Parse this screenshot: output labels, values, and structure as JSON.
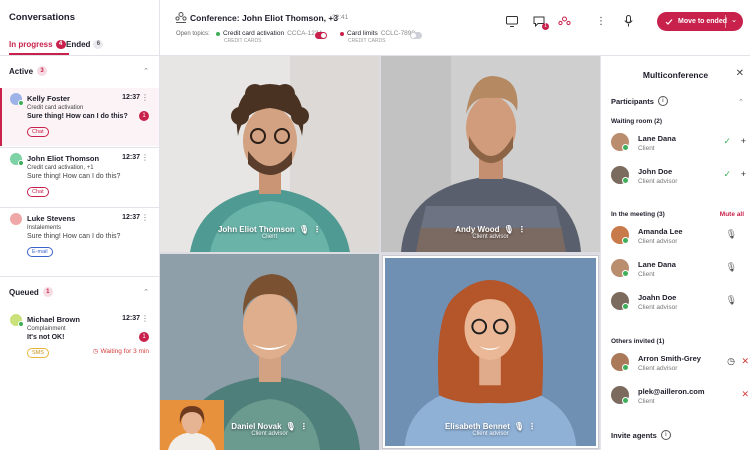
{
  "sidebar": {
    "title": "Conversations",
    "tabs": [
      {
        "label": "In progress",
        "count": "4"
      },
      {
        "label": "Ended",
        "count": "6"
      }
    ],
    "active_section": {
      "label": "Active",
      "count": "3"
    },
    "queued_section": {
      "label": "Queued",
      "count": "1"
    },
    "conversations": [
      {
        "name": "Kelly Foster",
        "time": "12:37",
        "subject": "Credit card activation",
        "message": "Sure thing! How can I do this?",
        "tag": "Chat",
        "unread": "1"
      },
      {
        "name": "John Eliot Thomson",
        "time": "12:37",
        "subject": "Credit card activation, +1",
        "message": "Sure thing! How can I do this?",
        "tag": "Chat"
      },
      {
        "name": "Luke Stevens",
        "time": "12:37",
        "subject": "Instalements",
        "message": "Sure thing! How can I do this?",
        "tag": "E-mail"
      }
    ],
    "queued": [
      {
        "name": "Michael Brown",
        "time": "12:37",
        "subject": "Complainment",
        "message": "It's not OK!",
        "tag": "SMS",
        "unread": "1",
        "waiting": "Waiting for 3 min"
      }
    ]
  },
  "header": {
    "title": "Conference: John Eliot Thomson, +3",
    "time": "22:41",
    "open_topics_label": "Open topics:",
    "topics": [
      {
        "label": "Credit card activation",
        "code": "CCCA-1234",
        "category": "CREDIT CARDS",
        "color": "#3fae5a",
        "enabled": true
      },
      {
        "label": "Card limits",
        "code": "CCLC-7890",
        "category": "CREDIT CARDS",
        "color": "#c8214b",
        "enabled": false
      }
    ],
    "move_button": "Move to ended"
  },
  "tiles": [
    {
      "name": "John Eliot Thomson",
      "role": "Client"
    },
    {
      "name": "Andy Wood",
      "role": "Client advisor"
    },
    {
      "name": "Daniel Novak",
      "role": "Client advisor"
    },
    {
      "name": "Elisabeth Bennet",
      "role": "Client advisor"
    }
  ],
  "panel": {
    "title": "Multiconference",
    "participants_label": "Participants",
    "waiting_room_label": "Waiting room (2)",
    "in_meeting_label": "In the meeting (3)",
    "mute_all_label": "Mute all",
    "others_invited_label": "Others invited (1)",
    "invite_agents_label": "Invite agents",
    "waiting": [
      {
        "name": "Lane Dana",
        "role": "Client"
      },
      {
        "name": "John Doe",
        "role": "Client advisor"
      }
    ],
    "meeting": [
      {
        "name": "Amanda Lee",
        "role": "Client advisor"
      },
      {
        "name": "Lane Dana",
        "role": "Client"
      },
      {
        "name": "Joahn Doe",
        "role": "Client advisor"
      }
    ],
    "invited": [
      {
        "name": "Arron Smith-Grey",
        "role": "Client advisor"
      },
      {
        "name": "plek@ailleron.com",
        "role": "Client"
      }
    ]
  },
  "colors": {
    "accent": "#c8214b",
    "online": "#3fae5a",
    "warning": "#d23c3c"
  }
}
